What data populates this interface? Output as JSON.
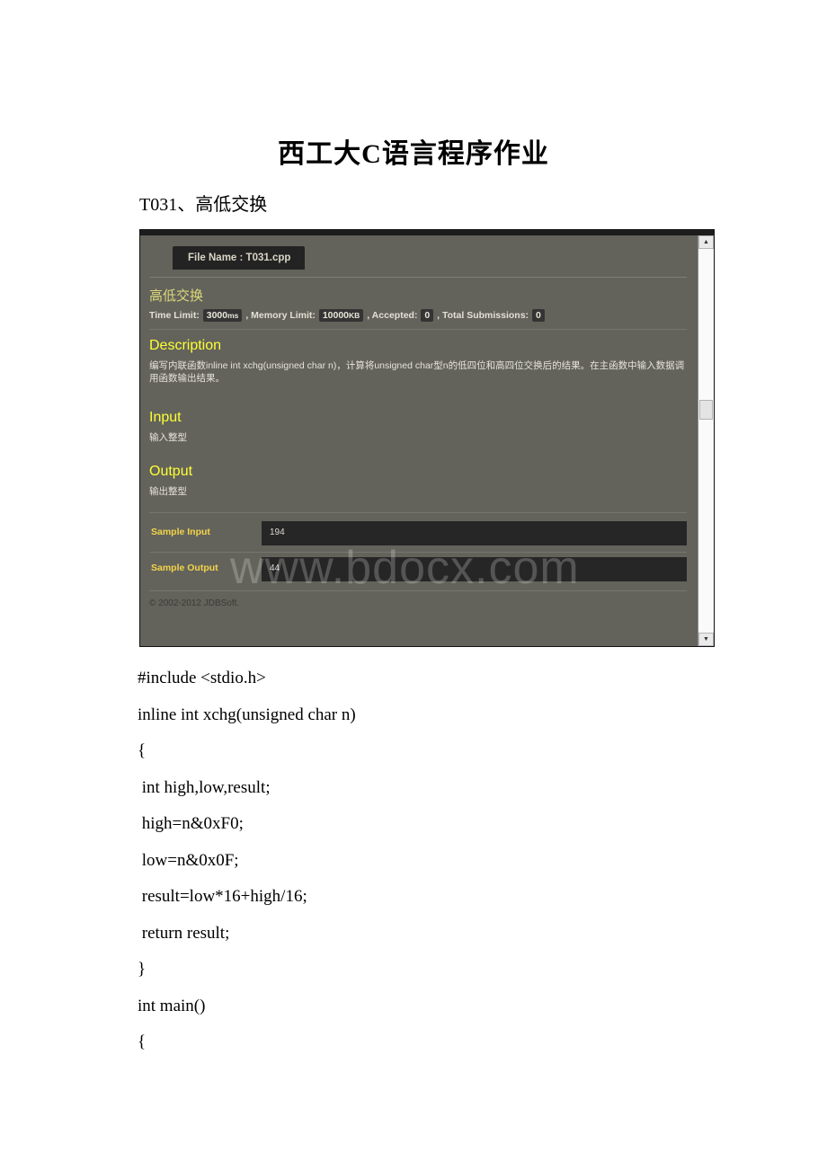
{
  "document": {
    "title": "西工大C语言程序作业",
    "subtitle": "T031、高低交换"
  },
  "oj_screenshot": {
    "file_tab_label": "File Name : T031.cpp",
    "problem_title": "高低交换",
    "limits": {
      "time_limit_label": "Time Limit:",
      "time_limit_value": "3000",
      "time_limit_unit": "ms",
      "memory_limit_label": ", Memory Limit:",
      "memory_limit_value": "10000",
      "memory_limit_unit": "KB",
      "accepted_label": ", Accepted:",
      "accepted_value": "0",
      "submissions_label": ", Total Submissions:",
      "submissions_value": "0"
    },
    "sections": [
      {
        "heading": "Description",
        "body": "编写内联函数inline int xchg(unsigned char n)，计算将unsigned char型n的低四位和高四位交换后的结果。在主函数中输入数据调用函数输出结果。"
      },
      {
        "heading": "Input",
        "body": "输入整型"
      },
      {
        "heading": "Output",
        "body": "输出整型"
      }
    ],
    "samples": [
      {
        "label": "Sample Input",
        "value": "194"
      },
      {
        "label": "Sample Output",
        "value": "44"
      }
    ],
    "footer": "© 2002-2012  JDBSoft.",
    "scrollbar": {
      "up_arrow": "▲",
      "down_arrow": "▼"
    }
  },
  "watermark": "www.bdocx.com",
  "code": {
    "lines": [
      "#include <stdio.h>",
      "inline int xchg(unsigned char n)",
      "{",
      " int high,low,result;",
      " high=n&0xF0;",
      " low=n&0x0F;",
      " result=low*16+high/16;",
      " return result;",
      "}",
      "int main()",
      "{"
    ]
  }
}
